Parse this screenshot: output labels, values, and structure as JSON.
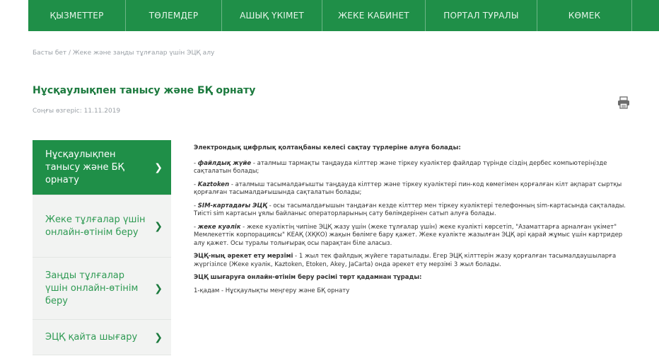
{
  "nav": {
    "items": [
      {
        "label": "ҚЫЗМЕТТЕР"
      },
      {
        "label": "ТӨЛЕМДЕР"
      },
      {
        "label": "АШЫҚ ҮКІМЕТ"
      },
      {
        "label": "ЖЕКЕ КАБИНЕТ"
      },
      {
        "label": "ПОРТАЛ ТУРАЛЫ"
      },
      {
        "label": "КӨМЕК"
      }
    ]
  },
  "breadcrumb": "Басты бет / Жеке және заңды тұлғалар үшін ЭЦҚ алу",
  "page": {
    "title": "Нұсқаулықпен танысу және БҚ орнату",
    "updated": "Соңғы өзгеріс: 11.11.2019",
    "print_icon": "printer-icon"
  },
  "sidebar": {
    "items": [
      {
        "label": "Нұсқаулықпен танысу және БҚ орнату",
        "active": true
      },
      {
        "label": "Жеке тұлғалар үшін онлайн-өтінім беру",
        "active": false
      },
      {
        "label": "Заңды тұлғалар үшін онлайн-өтінім беру",
        "active": false
      },
      {
        "label": "ЭЦҚ қайта шығару",
        "active": false
      }
    ]
  },
  "content": {
    "intro": "Электрондық цифрлық қолтаңбаны келесі сақтау түрлеріне алуға болады:",
    "p1_term": "файлдық жүйе",
    "p1_text": " - аталмыш тармақты таңдауда кілттер және тіркеу куәліктер файлдар түрінде сіздің дербес компьютеріңізде сақталатын болады;",
    "p2_term": "Kaztoken",
    "p2_text": " - аталмыш тасымалдағышты таңдауда кілттер және тіркеу куәліктері пин-код көмегімен қорғалған кілт ақпарат сыртқы қорғалған тасымалдағышында сақталатын болады;",
    "p3_term": "SIM-картадағы ЭЦҚ",
    "p3_text": " - осы тасымалдағышын таңдаған кезде кілттер мен тіркеу куәліктері телефонның sim-картасында сақталады. Тиісті sim картасын ұялы байланыс операторларының сату бөлімдерінен сатып алуға болады.",
    "p4_term": "жеке куәлік",
    "p4_text": " - жеке куәліктің чипіне ЭЦҚ жазу үшін (жеке тұлғалар үшін) жеке куәлікті көрсетіп, \"Азаматтарға арналған үкімет\" Мемлекеттік корпорациясы\" КЕАҚ (ХҚКО) жақын бөлімге бару қажет. Жеке куәлікте жазылған ЭЦҚ әрі қарай жұмыс үшін картридер алу қажет. Осы туралы толығырақ осы парақтан біле аласыз.",
    "p5_term": "ЭЦҚ-ның әрекет ету мерзімі",
    "p5_text": " - 1 жыл тек файлдық жүйеге таратылады. Егер ЭЦҚ кілттерін жазу қорғалған тасымалдаушыларға жүргізілсе (Жеке куәлік, Kaztoken, Etoken, Akey, JaCarta) онда әрекет ету мерзімі 3 жыл болады.",
    "p6": "ЭЦҚ шығаруға онлайн-өтінім беру рәсімі төрт қадамнан тұрады:",
    "p7": "1-қадам - Нұсқаулықты меңгеру және БҚ орнату"
  }
}
